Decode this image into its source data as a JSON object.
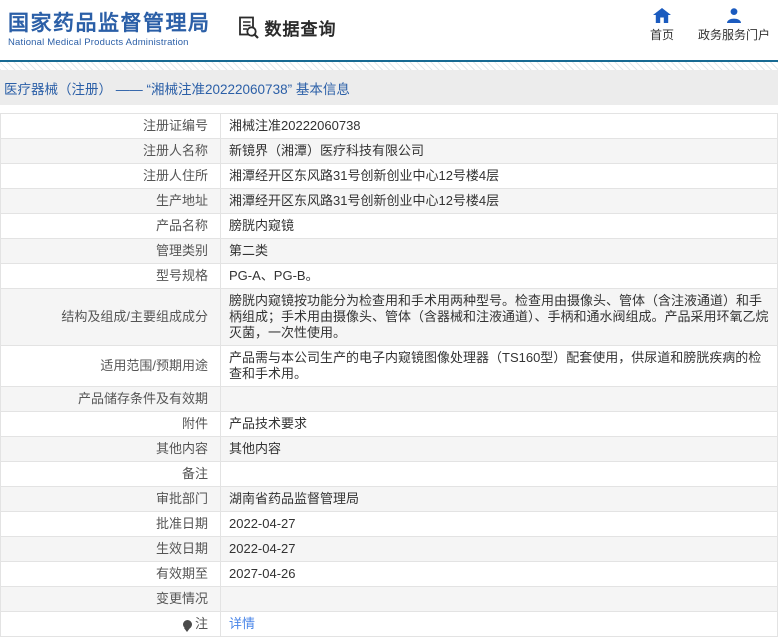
{
  "colors": {
    "brand_blue": "#2b5fa7",
    "nav_icon_blue": "#1b5bbf",
    "divider_teal": "#176a93",
    "breadcrumb_bg": "#ececec",
    "row_alt_bg": "#f5f5f5",
    "link_blue": "#4a86e8",
    "text_dark": "#333333",
    "label_gray": "#555555"
  },
  "header": {
    "logo_title": "国家药品监督管理局",
    "logo_subtitle": "National Medical Products Administration",
    "data_query_label": "数据查询",
    "nav": {
      "home_label": "首页",
      "portal_label": "政务服务门户"
    }
  },
  "breadcrumb": {
    "text": "医疗器械（注册） —— “湘械注准20222060738” 基本信息"
  },
  "table": {
    "rows": [
      {
        "label": "注册证编号",
        "value": "湘械注准20222060738"
      },
      {
        "label": "注册人名称",
        "value": "新镜界（湘潭）医疗科技有限公司"
      },
      {
        "label": "注册人住所",
        "value": "湘潭经开区东风路31号创新创业中心12号楼4层"
      },
      {
        "label": "生产地址",
        "value": "湘潭经开区东风路31号创新创业中心12号楼4层"
      },
      {
        "label": "产品名称",
        "value": "膀胱内窥镜"
      },
      {
        "label": "管理类别",
        "value": "第二类"
      },
      {
        "label": "型号规格",
        "value": "PG-A、PG-B。"
      },
      {
        "label": "结构及组成/主要组成成分",
        "value": "膀胱内窥镜按功能分为检查用和手术用两种型号。检查用由摄像头、管体（含注液通道）和手柄组成；手术用由摄像头、管体（含器械和注液通道）、手柄和通水阀组成。产品采用环氧乙烷灭菌，一次性使用。"
      },
      {
        "label": "适用范围/预期用途",
        "value": "产品需与本公司生产的电子内窥镜图像处理器（TS160型）配套使用，供尿道和膀胱疾病的检查和手术用。"
      },
      {
        "label": "产品储存条件及有效期",
        "value": ""
      },
      {
        "label": "附件",
        "value": "产品技术要求"
      },
      {
        "label": "其他内容",
        "value": "其他内容"
      },
      {
        "label": "备注",
        "value": ""
      },
      {
        "label": "审批部门",
        "value": "湖南省药品监督管理局"
      },
      {
        "label": "批准日期",
        "value": "2022-04-27"
      },
      {
        "label": "生效日期",
        "value": "2022-04-27"
      },
      {
        "label": "有效期至",
        "value": "2027-04-26"
      },
      {
        "label": "变更情况",
        "value": ""
      },
      {
        "label": "注",
        "value": "详情",
        "icon": "note-pin-icon",
        "link": true
      }
    ]
  }
}
